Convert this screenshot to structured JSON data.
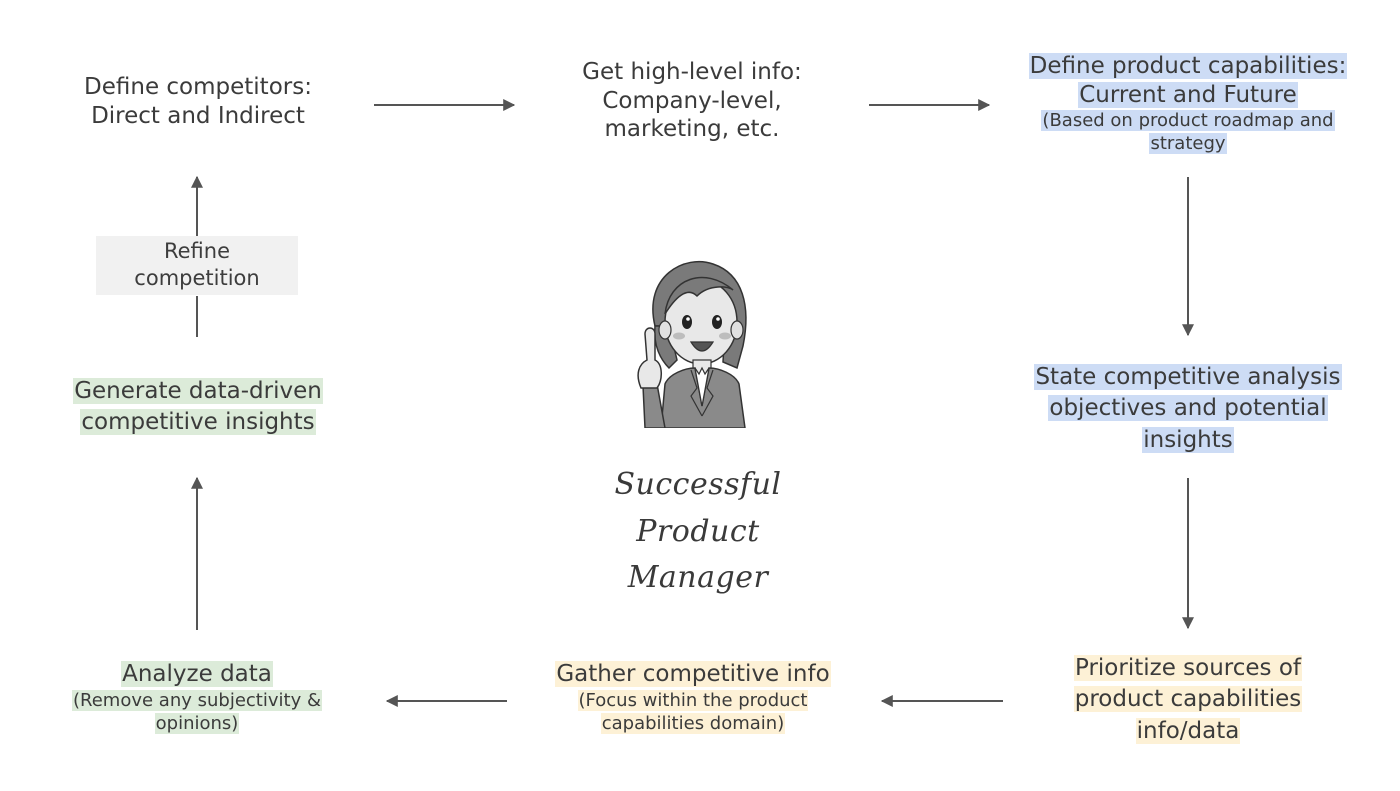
{
  "diagram": {
    "center": {
      "illustration": "businesswoman-pointing-icon",
      "caption_line1": "Successful Product",
      "caption_line2": "Manager"
    },
    "steps": [
      {
        "id": "define-competitors",
        "lines": [
          "Define competitors:",
          "Direct and Indirect"
        ],
        "sub": [],
        "highlight": "none"
      },
      {
        "id": "high-level-info",
        "lines": [
          "Get high-level info:",
          "Company-level,",
          "marketing, etc."
        ],
        "sub": [],
        "highlight": "none"
      },
      {
        "id": "define-capabilities",
        "lines": [
          "Define product capabilities:",
          "Current and Future"
        ],
        "sub": [
          "(Based on product roadmap and",
          "strategy"
        ],
        "highlight": "blue"
      },
      {
        "id": "state-objectives",
        "lines": [
          "State competitive analysis",
          "objectives and potential",
          "insights"
        ],
        "sub": [],
        "highlight": "blue"
      },
      {
        "id": "prioritize-sources",
        "lines": [
          "Prioritize sources of",
          "product capabilities",
          "info/data"
        ],
        "sub": [],
        "highlight": "yellow"
      },
      {
        "id": "gather-info",
        "lines": [
          "Gather competitive info"
        ],
        "sub": [
          "(Focus within the product",
          "capabilities domain)"
        ],
        "highlight": "yellow"
      },
      {
        "id": "analyze-data",
        "lines": [
          "Analyze data"
        ],
        "sub": [
          "(Remove any subjectivity &",
          "opinions)"
        ],
        "highlight": "green"
      },
      {
        "id": "generate-insights",
        "lines": [
          "Generate data-driven",
          "competitive insights"
        ],
        "sub": [],
        "highlight": "green"
      }
    ],
    "edge_label": {
      "lines": [
        "Refine",
        "competition"
      ]
    },
    "colors": {
      "highlight_blue": "#cddcf5",
      "highlight_yellow": "#fdf1d6",
      "highlight_green": "#dcebd9",
      "arrow": "#555555",
      "text": "#3b3b3b"
    }
  }
}
